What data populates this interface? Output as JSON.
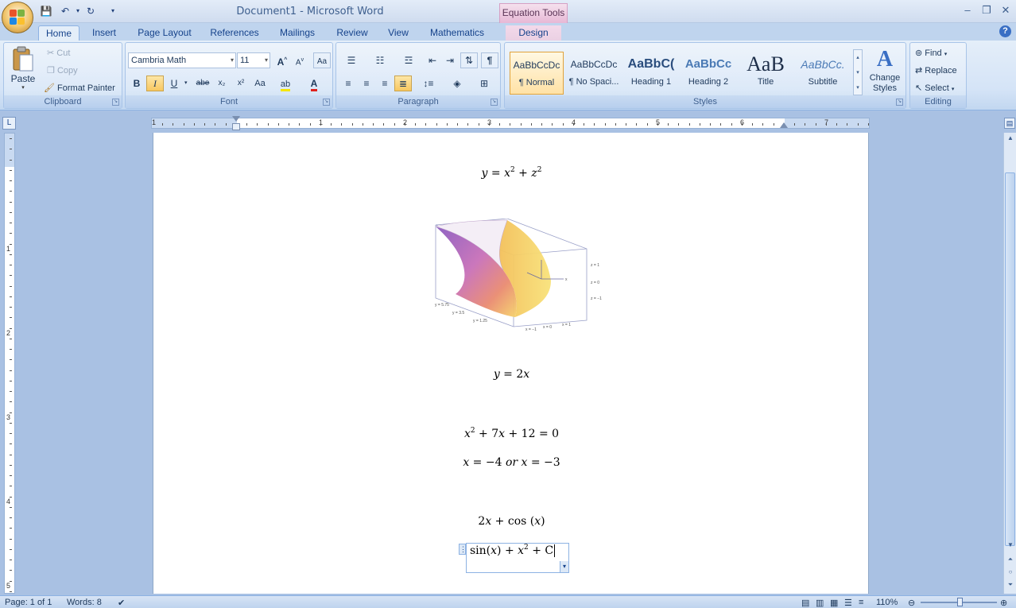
{
  "titlebar": {
    "title": "Document1 - Microsoft Word",
    "context_tab_header": "Equation Tools",
    "qat_save": "💾",
    "qat_undo": "↶",
    "qat_redo": "↻",
    "qat_more": "▾"
  },
  "tabs": [
    "Home",
    "Insert",
    "Page Layout",
    "References",
    "Mailings",
    "Review",
    "View",
    "Mathematics",
    "Design"
  ],
  "ribbon": {
    "clipboard": {
      "label": "Clipboard",
      "paste": "Paste",
      "cut": "Cut",
      "copy": "Copy",
      "format_painter": "Format Painter"
    },
    "font": {
      "label": "Font",
      "font_name": "Cambria Math",
      "font_size": "11",
      "bold": "B",
      "italic": "I",
      "underline": "U",
      "strike": "abe",
      "sub": "x₂",
      "sup": "x²",
      "case": "Aa",
      "grow": "A",
      "shrink": "A"
    },
    "paragraph": {
      "label": "Paragraph",
      "pilcrow": "¶"
    },
    "styles": {
      "label": "Styles",
      "items": [
        {
          "preview": "AaBbCcDc",
          "name": "¶ Normal"
        },
        {
          "preview": "AaBbCcDc",
          "name": "¶ No Spaci..."
        },
        {
          "preview": "AaBbC(",
          "name": "Heading 1"
        },
        {
          "preview": "AaBbCc",
          "name": "Heading 2"
        },
        {
          "preview": "AaB",
          "name": "Title"
        },
        {
          "preview": "AaBbCc.",
          "name": "Subtitle"
        }
      ],
      "change_styles": "Change Styles"
    },
    "editing": {
      "label": "Editing",
      "find": "Find",
      "replace": "Replace",
      "select": "Select"
    }
  },
  "document": {
    "eq1": "y = x² + z²",
    "eq2": "y = 2x",
    "eq3": "x² + 7x + 12 = 0",
    "eq4": "x = −4 or x = −3",
    "eq5": "2x + cos (x)",
    "eq6": "sin(x) + x² + C",
    "plot_labels": {
      "y1": "y = 5.75",
      "y2": "y = 3.5",
      "y3": "y = 1.25",
      "x1": "x = −1",
      "x2": "x = 0",
      "x3": "x = 1",
      "z1": "z = 1",
      "z2": "z = 0",
      "z3": "z = −1",
      "axis_x": "x"
    }
  },
  "ruler": {
    "h_numbers": [
      "1",
      "1",
      "2",
      "3",
      "4",
      "5",
      "6",
      "7"
    ],
    "v_numbers": [
      "1",
      "1",
      "2",
      "3",
      "4",
      "5"
    ]
  },
  "statusbar": {
    "page": "Page: 1 of 1",
    "words": "Words: 8",
    "zoom": "110%"
  }
}
